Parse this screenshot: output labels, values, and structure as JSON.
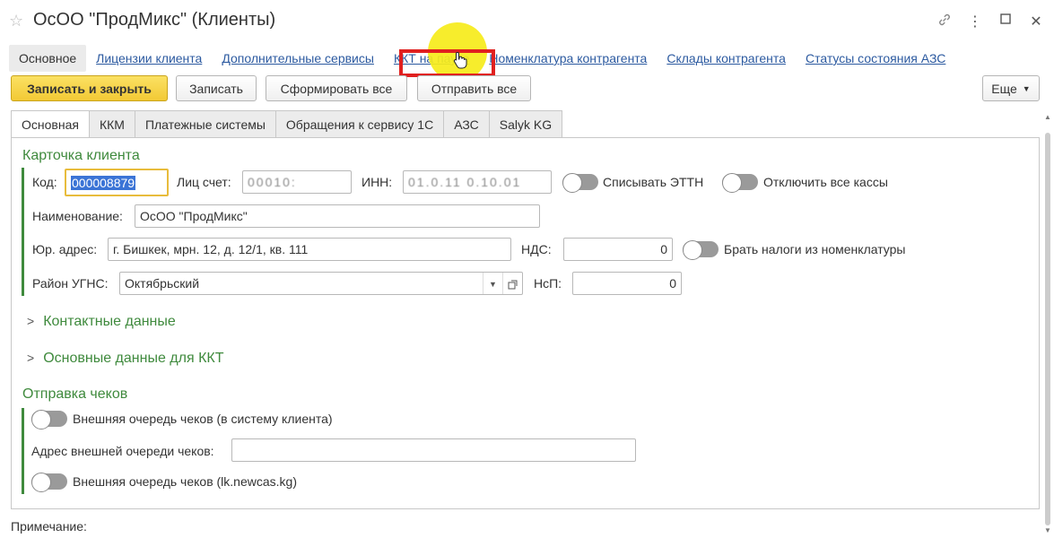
{
  "window": {
    "title": "ОсОО \"ПродМикс\" (Клиенты)"
  },
  "icons": {
    "star": "star-icon",
    "link": "link-icon",
    "menu": "more-icon",
    "maximize": "maximize-icon",
    "close": "close-icon",
    "cursor": "hand-pointer-icon"
  },
  "nav": {
    "tabs": [
      "Основное",
      "Лицензии клиента",
      "Дополнительные сервисы",
      "ККТ на паузе",
      "Номенклатура контрагента",
      "Склады контрагента",
      "Статусы состояния АЗС"
    ]
  },
  "toolbar": {
    "save_close": "Записать и закрыть",
    "save": "Записать",
    "form_all": "Сформировать все",
    "send_all": "Отправить все",
    "more": "Еще"
  },
  "tabs": [
    "Основная",
    "ККМ",
    "Платежные системы",
    "Обращения к сервису 1С",
    "АЗС",
    "Salyk KG"
  ],
  "card": {
    "title": "Карточка клиента",
    "code_label": "Код:",
    "code_value": "000008879",
    "account_label": "Лиц счет:",
    "account_value": "00010:",
    "inn_label": "ИНН:",
    "inn_value": "01.0.11 0.10.01",
    "ettn_label": "Списывать ЭТТН",
    "disable_kassy_label": "Отключить все кассы",
    "name_label": "Наименование:",
    "name_value": "ОсОО \"ПродМикс\"",
    "address_label": "Юр. адрес:",
    "address_value": "г. Бишкек, мрн. 12, д. 12/1, кв. 111",
    "nds_label": "НДС:",
    "nds_value": "0",
    "taxes_label": "Брать налоги из номенклатуры",
    "district_label": "Район УГНС:",
    "district_value": "Октябрьский",
    "nsp_label": "НсП:",
    "nsp_value": "0"
  },
  "sections": {
    "contacts": "Контактные данные",
    "kkt_data": "Основные данные для ККТ"
  },
  "receipts": {
    "title": "Отправка чеков",
    "external_queue": "Внешняя очередь чеков (в систему клиента)",
    "queue_address_label": "Адрес внешней очереди чеков:",
    "queue_address_value": "",
    "newcas_queue": "Внешняя очередь чеков (lk.newcas.kg)"
  },
  "footer": {
    "note_label": "Примечание:"
  },
  "colors": {
    "group_green": "#3f8a3d",
    "primary_button": "#f2c935",
    "link_blue": "#2c5aa0",
    "highlight_red": "#e0201f",
    "cursor_halo": "#f6ec1a"
  }
}
